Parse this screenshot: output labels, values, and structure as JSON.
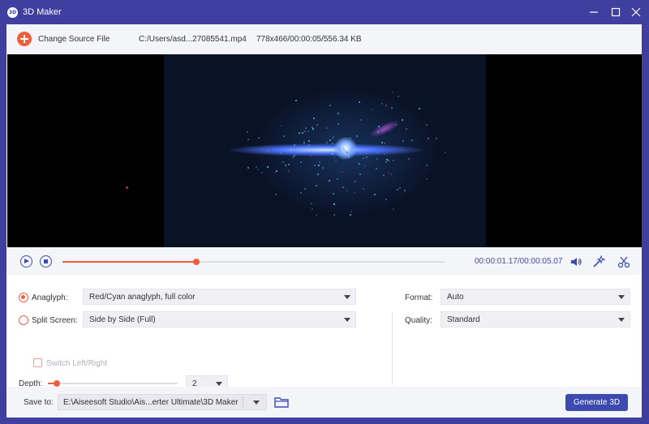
{
  "window": {
    "logo_text": "3D",
    "title": "3D Maker",
    "controls": [
      "minimize-icon",
      "maximize-icon",
      "close-icon"
    ]
  },
  "source": {
    "change_label": "Change Source File",
    "path": "C:/Users/asd...27085541.mp4",
    "info": "778x466/00:00:05/556.34 KB"
  },
  "playback": {
    "time": "00:00:01.17/00:00:05.07",
    "progress": 0.35,
    "icons": [
      "play-icon",
      "stop-icon",
      "volume-icon",
      "magic-wand-icon",
      "scissors-icon"
    ]
  },
  "settings": {
    "anaglyph": {
      "label": "Anaglyph:",
      "value": "Red/Cyan anaglyph, full color",
      "selected": true
    },
    "split_screen": {
      "label": "Split Screen:",
      "value": "Side by Side (Full)",
      "selected": false
    },
    "switch_lr": {
      "label": "Switch Left/Right",
      "checked": false,
      "enabled": false
    },
    "depth": {
      "label": "Depth:",
      "value": "2",
      "slider_fraction": 0.07
    },
    "format": {
      "label": "Format:",
      "value": "Auto"
    },
    "quality": {
      "label": "Quality:",
      "value": "Standard"
    }
  },
  "save": {
    "label": "Save to:",
    "path": "E:\\Aiseesoft Studio\\Ais...erter Ultimate\\3D Maker",
    "generate_label": "Generate 3D"
  },
  "colors": {
    "accent": "#f05f3c",
    "primary": "#3d4bb0",
    "titlebar": "#3f3f9f"
  }
}
